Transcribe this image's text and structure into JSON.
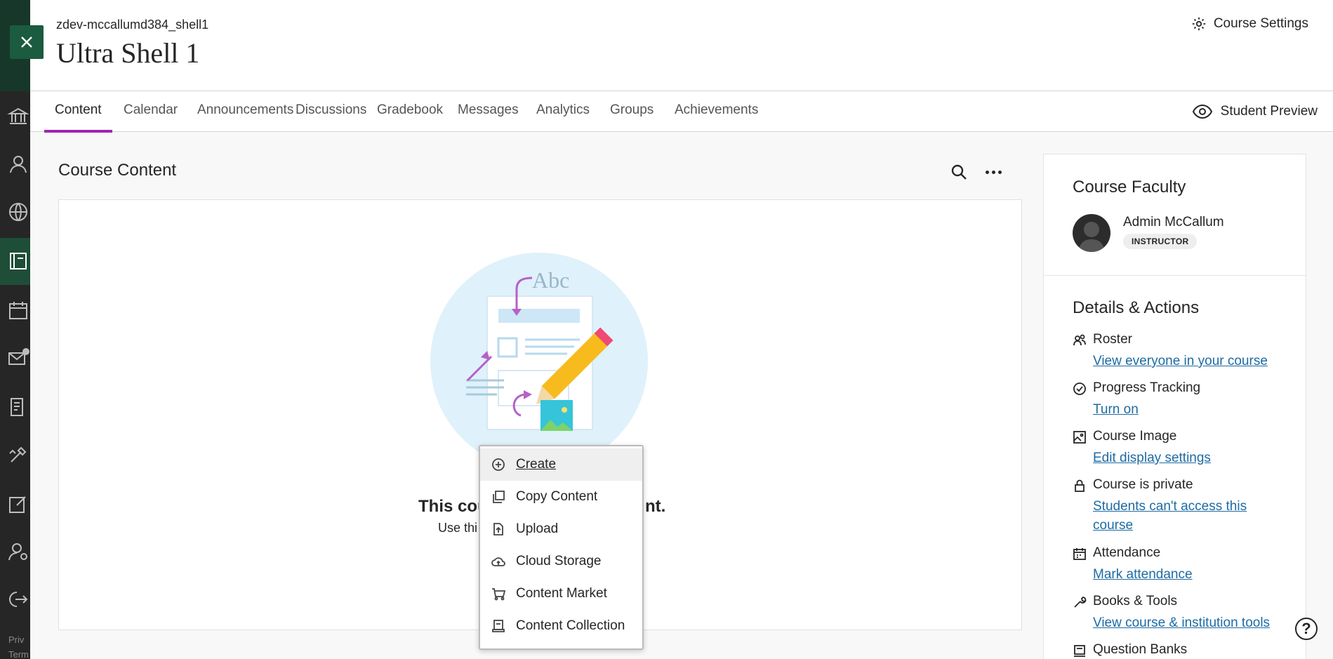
{
  "header": {
    "course_id": "zdev-mccallumd384_shell1",
    "course_title": "Ultra Shell 1",
    "settings_label": "Course Settings"
  },
  "tabs": [
    {
      "label": "Content",
      "active": true
    },
    {
      "label": "Calendar"
    },
    {
      "label": "Announcements"
    },
    {
      "label": "Discussions"
    },
    {
      "label": "Gradebook"
    },
    {
      "label": "Messages"
    },
    {
      "label": "Analytics"
    },
    {
      "label": "Groups"
    },
    {
      "label": "Achievements"
    }
  ],
  "student_preview_label": "Student Preview",
  "content": {
    "title": "Course Content",
    "empty_title_start": "This cou",
    "empty_title_end": "nt.",
    "empty_sub": "Use thi",
    "illustration_text": "Abc"
  },
  "menu": {
    "items": [
      {
        "label": "Create",
        "icon": "plus-circle-icon"
      },
      {
        "label": "Copy Content",
        "icon": "copy-icon"
      },
      {
        "label": "Upload",
        "icon": "upload-icon"
      },
      {
        "label": "Cloud Storage",
        "icon": "cloud-upload-icon"
      },
      {
        "label": "Content Market",
        "icon": "cart-icon"
      },
      {
        "label": "Content Collection",
        "icon": "collection-icon"
      }
    ]
  },
  "sidebar": {
    "faculty_title": "Course Faculty",
    "faculty_name": "Admin McCallum",
    "faculty_role": "INSTRUCTOR",
    "details_title": "Details & Actions",
    "items": [
      {
        "label": "Roster",
        "link": "View everyone in your course"
      },
      {
        "label": "Progress Tracking",
        "link": "Turn on"
      },
      {
        "label": "Course Image",
        "link": "Edit display settings"
      },
      {
        "label": "Course is private",
        "link": "Students can't access this course"
      },
      {
        "label": "Attendance",
        "link": "Mark attendance"
      },
      {
        "label": "Books & Tools",
        "link": "View course & institution tools"
      },
      {
        "label": "Question Banks",
        "link": ""
      }
    ]
  },
  "rail": {
    "privacy_text": "Priv",
    "terms_text": "Term"
  },
  "help_label": "?"
}
